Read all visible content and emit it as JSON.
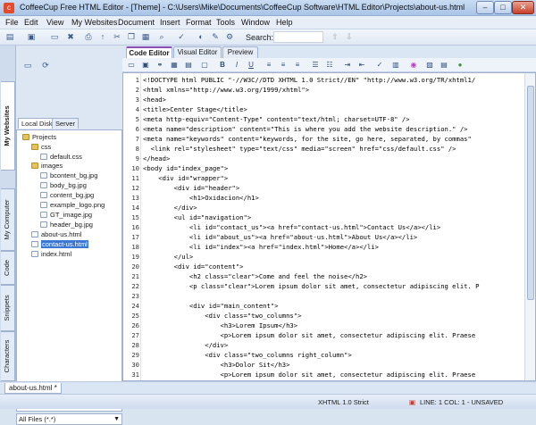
{
  "window": {
    "title": "CoffeeCup Free HTML Editor - [Theme] - C:\\Users\\Mike\\Documents\\CoffeeCup Software\\HTML Editor\\Projects\\about-us.html"
  },
  "menu": [
    "File",
    "Edit",
    "View",
    "My Websites",
    "Document",
    "Insert",
    "Format",
    "Tools",
    "Window",
    "Help"
  ],
  "toolbar": {
    "search_label": "Search:",
    "search_value": ""
  },
  "side_tabs": [
    "My Websites",
    "My Computer",
    "Code",
    "Snippets",
    "Characters"
  ],
  "left_panel": {
    "tabs": [
      "Local Disk",
      "Server"
    ],
    "tree": [
      {
        "label": "Projects",
        "type": "folder"
      },
      {
        "label": "css",
        "type": "folder"
      },
      {
        "label": "default.css",
        "type": "file"
      },
      {
        "label": "images",
        "type": "folder"
      },
      {
        "label": "bcontent_bg.jpg",
        "type": "file"
      },
      {
        "label": "body_bg.jpg",
        "type": "file"
      },
      {
        "label": "content_bg.jpg",
        "type": "file"
      },
      {
        "label": "example_logo.png",
        "type": "file"
      },
      {
        "label": "GT_image.jpg",
        "type": "file"
      },
      {
        "label": "header_bg.jpg",
        "type": "file"
      },
      {
        "label": "about-us.html",
        "type": "file"
      },
      {
        "label": "contact-us.html",
        "type": "file",
        "selected": true
      },
      {
        "label": "index.html",
        "type": "file"
      }
    ],
    "filter": "All Files (*.*)"
  },
  "editor_tabs": [
    "Code Editor",
    "Visual Editor",
    "Preview"
  ],
  "code_lines": [
    "<!DOCTYPE html PUBLIC \"-//W3C//DTD XHTML 1.0 Strict//EN\" \"http://www.w3.org/TR/xhtml1/",
    "<html xmlns=\"http://www.w3.org/1999/xhtml\">",
    "<head>",
    "<title>Center Stage</title>",
    "<meta http-equiv=\"Content-Type\" content=\"text/html; charset=UTF-8\" />",
    "<meta name=\"description\" content=\"This is where you add the website description.\" />",
    "<meta name=\"keywords\" content=\"keywords, for the site, go here, separated, by commas\"",
    "  <link rel=\"stylesheet\" type=\"text/css\" media=\"screen\" href=\"css/default.css\" />",
    "</head>",
    "<body id=\"index_page\">",
    "    <div id=\"wrapper\">",
    "        <div id=\"header\">",
    "            <h1>Oxidacion</h1>",
    "        </div>",
    "        <ul id=\"navigation\">",
    "            <li id=\"contact_us\"><a href=\"contact-us.html\">Contact Us</a></li>",
    "            <li id=\"about_us\"><a href=\"about-us.html\">About Us</a></li>",
    "            <li id=\"index\"><a href=\"index.html\">Home</a></li>",
    "        </ul>",
    "        <div id=\"content\">",
    "            <h2 class=\"clear\">Come and feel the noise</h2>",
    "            <p class=\"clear\">Lorem ipsum dolor sit amet, consectetur adipiscing elit. P",
    "",
    "            <div id=\"main_content\">",
    "                <div class=\"two_columns\">",
    "                    <h3>Lorem Ipsum</h3>",
    "                    <p>Lorem ipsum dolor sit amet, consectetur adipiscing elit. Praese",
    "                </div>",
    "                <div class=\"two_columns right_column\">",
    "                    <h3>Dolor Sit</h3>",
    "                    <p>Lorem ipsum dolor sit amet, consectetur adipiscing elit. Praese",
    "                </div>"
  ],
  "document_tab": "about-us.html *",
  "status": {
    "doctype": "XHTML 1.0 Strict",
    "position": "LINE: 1  COL: 1 - UNSAVED"
  }
}
